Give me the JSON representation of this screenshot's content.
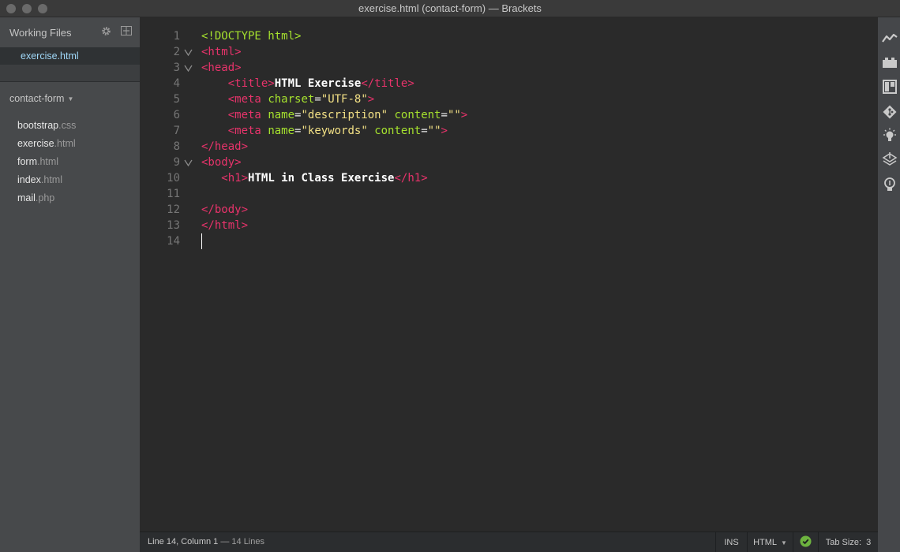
{
  "window": {
    "title": "exercise.html (contact-form) — Brackets"
  },
  "sidebar": {
    "working_files_label": "Working Files",
    "working_files": [
      {
        "name": "exercise.html"
      }
    ],
    "project_name": "contact-form",
    "files": [
      {
        "base": "bootstrap",
        "ext": ".css"
      },
      {
        "base": "exercise",
        "ext": ".html"
      },
      {
        "base": "form",
        "ext": ".html"
      },
      {
        "base": "index",
        "ext": ".html"
      },
      {
        "base": "mail",
        "ext": ".php"
      }
    ]
  },
  "editor": {
    "lines": [
      {
        "n": "1",
        "fold": "",
        "text": "<!DOCTYPE html>"
      },
      {
        "n": "2",
        "fold": "v",
        "text": "<html>"
      },
      {
        "n": "3",
        "fold": "v",
        "text": "<head>"
      },
      {
        "n": "4",
        "fold": "",
        "text": "    <title>HTML Exercise</title>"
      },
      {
        "n": "5",
        "fold": "",
        "text": "    <meta charset=\"UTF-8\">"
      },
      {
        "n": "6",
        "fold": "",
        "text": "    <meta name=\"description\" content=\"\">"
      },
      {
        "n": "7",
        "fold": "",
        "text": "    <meta name=\"keywords\" content=\"\">"
      },
      {
        "n": "8",
        "fold": "",
        "text": "</head>"
      },
      {
        "n": "9",
        "fold": "v",
        "text": "<body>"
      },
      {
        "n": "10",
        "fold": "",
        "text": "   <h1>HTML in Class Exercise</h1>"
      },
      {
        "n": "11",
        "fold": "",
        "text": ""
      },
      {
        "n": "12",
        "fold": "",
        "text": "</body>"
      },
      {
        "n": "13",
        "fold": "",
        "text": "</html>"
      },
      {
        "n": "14",
        "fold": "",
        "text": ""
      }
    ],
    "cursor_line": 14
  },
  "statusbar": {
    "position": "Line 14, Column 1",
    "lines_count": "— 14 Lines",
    "mode": "INS",
    "language": "HTML",
    "tab_size": "Tab Size:  3"
  },
  "right_toolbar": {
    "icons": [
      "live-preview-icon",
      "extension-manager-icon",
      "layout-icon",
      "git-icon",
      "lightbulb-icon",
      "layers-icon",
      "hint-bulb-icon"
    ]
  },
  "colors": {
    "tag": "#e8336b",
    "attribute": "#a6e22e",
    "string": "#f2e085",
    "lint_ok": "#6db33f"
  }
}
